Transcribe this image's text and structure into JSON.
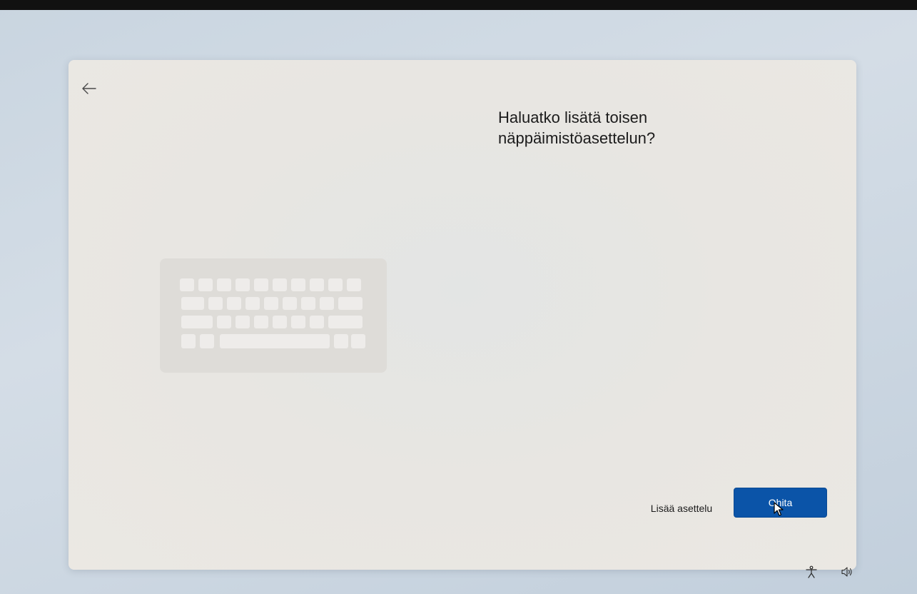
{
  "dialog": {
    "heading_line1": "Haluatko lisätä toisen",
    "heading_line2": "näppäimistöasettelun?",
    "back_icon": "arrow-left-icon"
  },
  "buttons": {
    "secondary_label": "Lisää asettelu",
    "primary_label": "Ohita"
  },
  "illustration": {
    "icon": "keyboard-illustration"
  },
  "system_tray": {
    "accessibility_icon": "accessibility-icon",
    "volume_icon": "volume-icon"
  },
  "colors": {
    "accent": "#0b54a8",
    "card_background": "#e8e6e2",
    "page_background": "#ccd6e0"
  }
}
